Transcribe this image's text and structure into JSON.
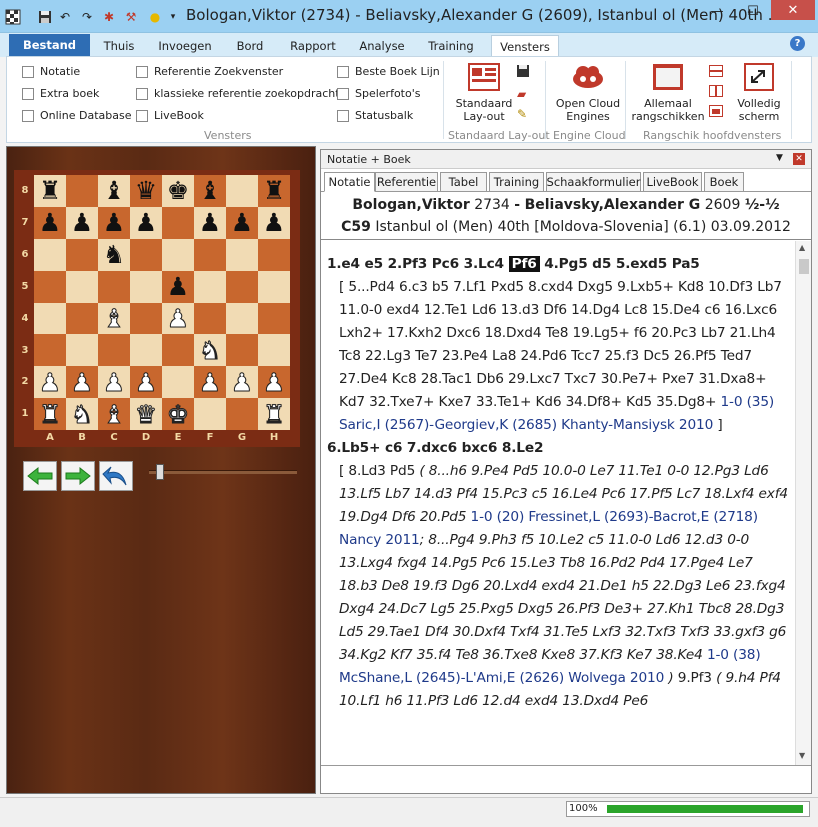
{
  "window": {
    "title": "Bologan,Viktor (2734) - Beliavsky,Alexander G (2609), Istanbul ol (Men) 40th ...",
    "close_glyph": "✕",
    "minimize_glyph": "—",
    "maximize_glyph": "☐"
  },
  "ribbon": {
    "tabs": [
      "Bestand",
      "Thuis",
      "Invoegen",
      "Bord",
      "Rapport",
      "Analyse",
      "Training",
      "Vensters"
    ],
    "active_tab": "Vensters",
    "checkboxes_col1": [
      "Notatie",
      "Extra boek",
      "Online Database"
    ],
    "checkboxes_col2": [
      "Referentie Zoekvenster",
      "klassieke referentie zoekopdracht",
      "LiveBook"
    ],
    "checkboxes_col3": [
      "Beste Boek Lijn",
      "Spelerfoto's",
      "Statusbalk"
    ],
    "group_vensters": "Vensters",
    "btn_standaard_layout_1": "Standaard",
    "btn_standaard_layout_2": "Lay-out",
    "group_standaard_layout": "Standaard Lay-out",
    "btn_cloud_1": "Open Cloud",
    "btn_cloud_2": "Engines",
    "group_engine_cloud": "Engine Cloud",
    "btn_allemaal_1": "Allemaal",
    "btn_allemaal_2": "rangschikken",
    "btn_volledig_1": "Volledig",
    "btn_volledig_2": "scherm",
    "group_rangschik": "Rangschik hoofdvensters"
  },
  "board": {
    "ranks": [
      "8",
      "7",
      "6",
      "5",
      "4",
      "3",
      "2",
      "1"
    ],
    "files": [
      "A",
      "B",
      "C",
      "D",
      "E",
      "F",
      "G",
      "H"
    ],
    "position": [
      [
        "br",
        "",
        "bb",
        "bq",
        "bk",
        "bb",
        "",
        "br"
      ],
      [
        "bp",
        "bp",
        "bp",
        "bp",
        "",
        "bp",
        "bp",
        "bp"
      ],
      [
        "",
        "",
        "bn",
        "",
        "",
        "",
        "",
        ""
      ],
      [
        "",
        "",
        "",
        "",
        "bp",
        "",
        "",
        ""
      ],
      [
        "",
        "",
        "wb",
        "",
        "wp",
        "",
        "",
        ""
      ],
      [
        "",
        "",
        "",
        "",
        "",
        "wn",
        "",
        ""
      ],
      [
        "wp",
        "wp",
        "wp",
        "wp",
        "",
        "wp",
        "wp",
        "wp"
      ],
      [
        "wr",
        "wn",
        "wb",
        "wq",
        "wk",
        "",
        "",
        "wr"
      ]
    ]
  },
  "notation_panel": {
    "title": "Notatie + Boek",
    "tabs": [
      "Notatie",
      "Referentie",
      "Tabel",
      "Training",
      "Schaakformulier",
      "LiveBook",
      "Boek"
    ],
    "white": "Bologan,Viktor",
    "white_elo": "2734",
    "sep": "-",
    "black": "Beliavsky,Alexander G",
    "black_elo": "2609",
    "result": "½-½",
    "eco": "C59",
    "event_line": "Istanbul ol (Men) 40th [Moldova-Slovenia] (6.1) 03.09.2012"
  },
  "moves": {
    "main1_a": "1.e4  e5  2.Pf3  Pc6  3.Lc4 ",
    "main1_cur": "Pf6",
    "main1_b": " 4.Pg5  d5  5.exd5  Pa5",
    "var1": "[ 5...Pd4  6.c3  b5  7.Lf1  Pxd5  8.cxd4  Dxg5  9.Lxb5+  Kd8  10.Df3  Lb7  11.0-0  exd4  12.Te1  Ld6  13.d3  Df6  14.Dg4  Lc8  15.De4  c6  16.Lxc6  Lxh2+  17.Kxh2  Dxc6  18.Dxd4  Te8  19.Lg5+  f6  20.Pc3  Lb7  21.Lh4  Tc8  22.Lg3  Te7  23.Pe4  La8  24.Pd6  Tcc7  25.f3  Dc5  26.Pf5  Ted7  27.De4  Kc8  28.Tac1  Db6  29.Lxc7  Txc7  30.Pe7+  Pxe7  31.Dxa8+  Kd7  32.Txe7+  Kxe7  33.Te1+  Kd6  34.Df8+  Kd5  35.Dg8+ ",
    "var1_ref": "1-0 (35) Saric,I (2567)-Georgiev,K (2685) Khanty-Mansiysk 2010",
    "var1_end": " ]",
    "main2": "6.Lb5+  c6  7.dxc6  bxc6  8.Le2",
    "var2_a": "[ 8.Ld3  Pd5  ",
    "var2_it1": "( 8...h6  9.Pe4  Pd5  10.0-0  Le7  11.Te1  0-0  12.Pg3  Ld6  13.Lf5  Lb7  14.d3  Pf4  15.Pc3  c5  16.Le4  Pc6  17.Pf5  Lc7  18.Lxf4  exf4  19.Dg4  Df6  20.Pd5 ",
    "var2_ref1": "1-0 (20) Fressinet,L (2693)-Bacrot,E (2718) Nancy 2011",
    "var2_it2": "; 8...Pg4  9.Ph3  f5  10.Le2  c5  11.0-0  Ld6  12.d3  0-0  13.Lxg4  fxg4  14.Pg5  Pc6  15.Le3  Tb8  16.Pd2  Pd4  17.Pge4  Le7  18.b3  De8  19.f3  Dg6  20.Lxd4  exd4  21.De1  h5  22.Dg3  Le6  23.fxg4  Dxg4  24.Dc7  Lg5  25.Pxg5  Dxg5  26.Pf3  De3+  27.Kh1  Tbc8  28.Dg3  Ld5  29.Tae1  Df4  30.Dxf4  Txf4  31.Te5  Lxf3  32.Txf3  Txf3  33.gxf3  g6  34.Kg2  Kf7  35.f4  Te8  36.Txe8  Kxe8  37.Kf3  Ke7  38.Ke4 ",
    "var2_ref2": "1-0 (38) McShane,L (2645)-L'Ami,E (2626) Wolvega 2010",
    "var2_it3_close": " )",
    "var2_b": " 9.Pf3 ",
    "var2_it4": "( 9.h4  Pf4  10.Lf1  h6  11.Pf3  Ld6  12.d4  exd4  13.Dxd4  Pe6"
  },
  "status": {
    "progress_text": "100%",
    "progress": 1.0
  },
  "colors": {
    "titlebar": "#9bd0f2",
    "file_tab": "#2e6db4",
    "board_light": "#f1dbb4",
    "board_dark": "#c8672e",
    "reference": "#1f3a8a",
    "progress": "#2aa42a"
  }
}
